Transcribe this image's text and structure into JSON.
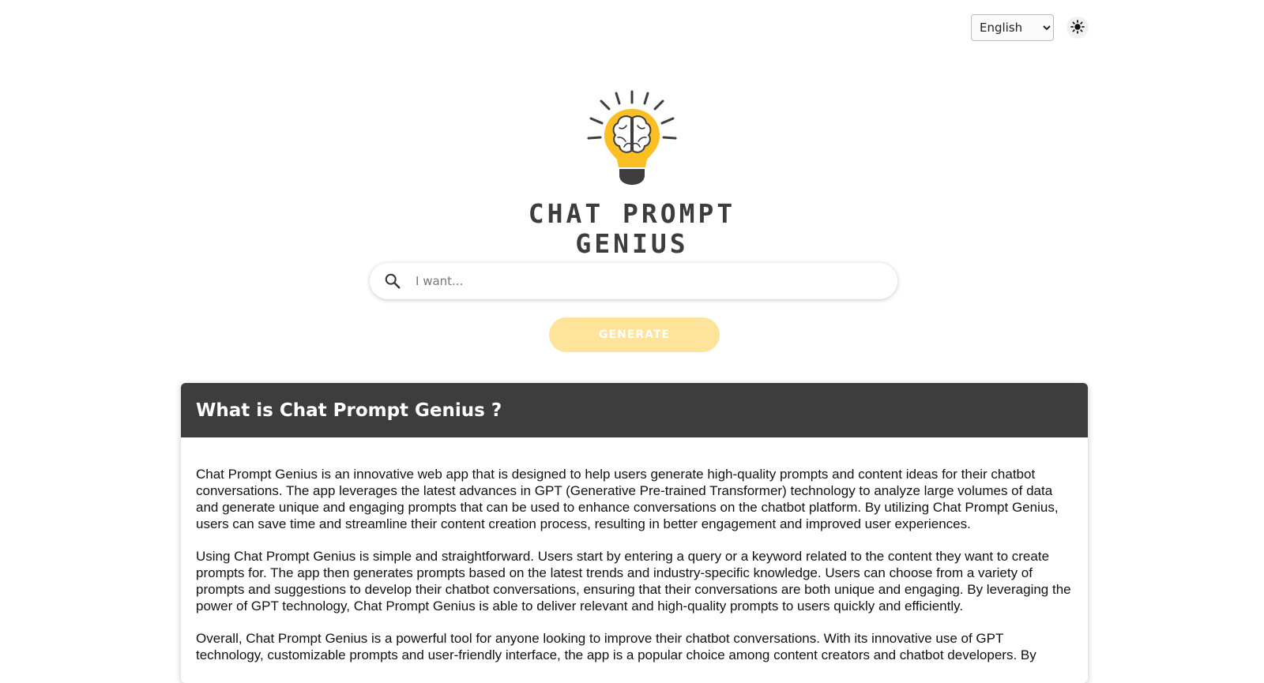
{
  "header": {
    "language_select": {
      "selected": "English",
      "options": [
        "English"
      ]
    },
    "theme_toggle_icon": "sun-icon"
  },
  "logo": {
    "icon": "lightbulb-brain-icon",
    "line1": "CHAT PROMPT",
    "line2": "GENIUS"
  },
  "search": {
    "placeholder": "I want...",
    "value": "",
    "icon": "search-icon"
  },
  "generate_button": {
    "label": "GENERATE"
  },
  "about": {
    "title": "What is Chat Prompt Genius ?",
    "paragraphs": [
      "Chat Prompt Genius is an innovative web app that is designed to help users generate high-quality prompts and content ideas for their chatbot conversations. The app leverages the latest advances in GPT (Generative Pre-trained Transformer) technology to analyze large volumes of data and generate unique and engaging prompts that can be used to enhance conversations on the chatbot platform. By utilizing Chat Prompt Genius, users can save time and streamline their content creation process, resulting in better engagement and improved user experiences.",
      "Using Chat Prompt Genius is simple and straightforward. Users start by entering a query or a keyword related to the content they want to create prompts for. The app then generates prompts based on the latest trends and industry-specific knowledge. Users can choose from a variety of prompts and suggestions to develop their chatbot conversations, ensuring that their conversations are both unique and engaging. By leveraging the power of GPT technology, Chat Prompt Genius is able to deliver relevant and high-quality prompts to users quickly and efficiently.",
      "Overall, Chat Prompt Genius is a powerful tool for anyone looking to improve their chatbot conversations. With its innovative use of GPT technology, customizable prompts and user-friendly interface, the app is a popular choice among content creators and chatbot developers. By"
    ]
  },
  "colors": {
    "accent_yellow": "#fbbf24",
    "button_disabled": "#fde49a",
    "header_dark": "#3d3d3d"
  }
}
